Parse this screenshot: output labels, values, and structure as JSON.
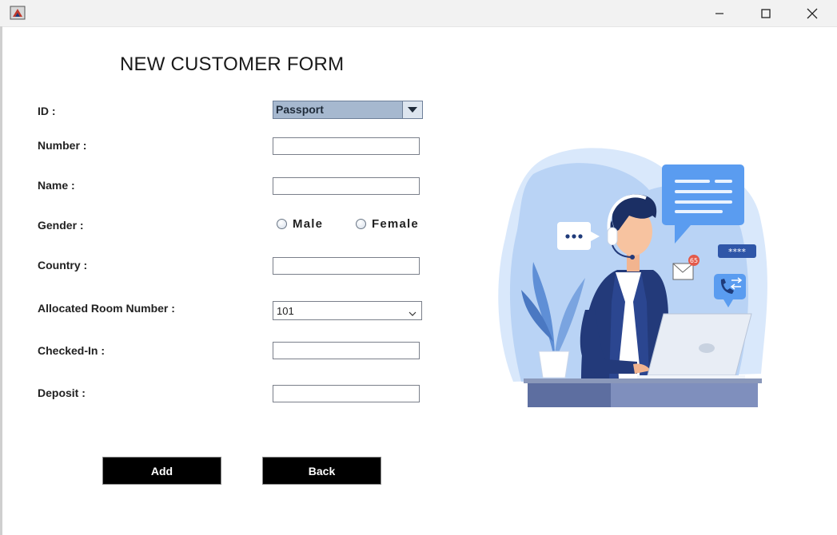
{
  "window": {
    "icons": {
      "app": "java-app-icon",
      "minimize": "minimize-icon",
      "maximize": "maximize-icon",
      "close": "close-icon"
    }
  },
  "form": {
    "title": "NEW CUSTOMER FORM",
    "labels": {
      "id": "ID :",
      "number": "Number :",
      "name": "Name :",
      "gender": "Gender :",
      "country": "Country :",
      "room": "Allocated Room Number :",
      "checked_in": "Checked-In :",
      "deposit": "Deposit :"
    },
    "id_select": {
      "selected": "Passport"
    },
    "room_select": {
      "selected": "101"
    },
    "inputs": {
      "number": "",
      "name": "",
      "country": "",
      "checked_in": "",
      "deposit": ""
    },
    "gender_options": {
      "male": "Male",
      "female": "Female"
    },
    "buttons": {
      "add": "Add",
      "back": "Back"
    }
  },
  "illustration": {
    "icon": "customer-support-agent-illustration",
    "badge_count": "65"
  }
}
